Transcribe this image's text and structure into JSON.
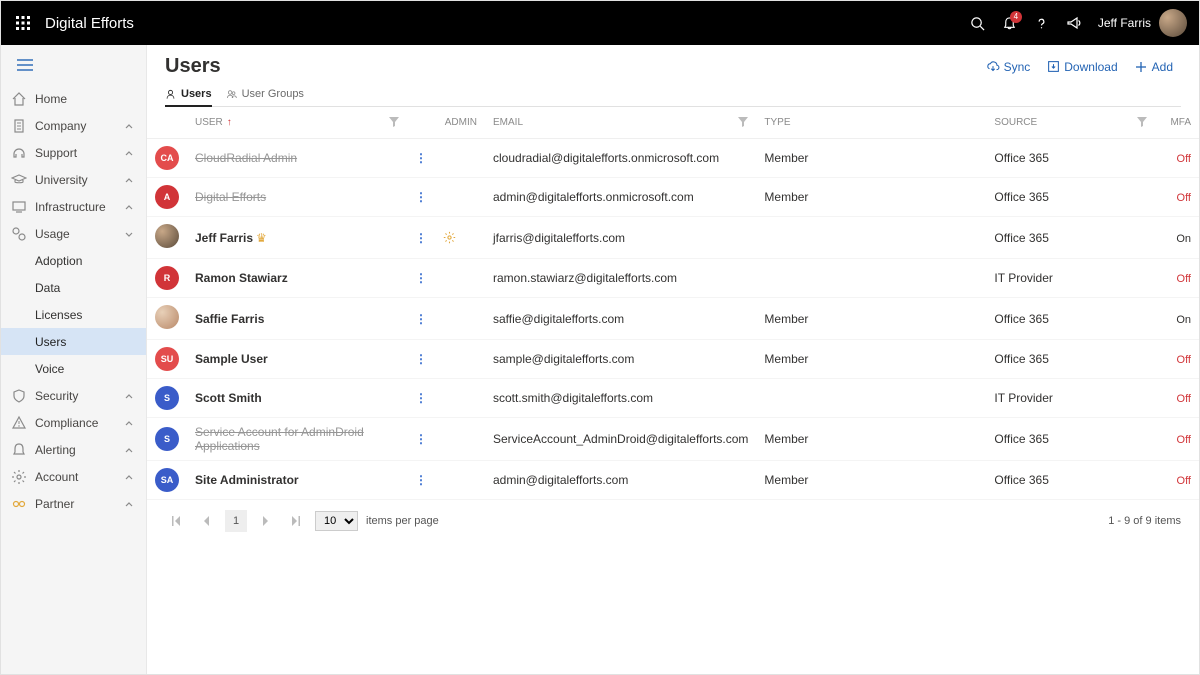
{
  "header": {
    "brand": "Digital Efforts",
    "notification_count": "4",
    "user_name": "Jeff Farris"
  },
  "sidebar": {
    "items": [
      {
        "label": "Home",
        "icon": "home",
        "expandable": false
      },
      {
        "label": "Company",
        "icon": "building",
        "expandable": true
      },
      {
        "label": "Support",
        "icon": "headset",
        "expandable": true
      },
      {
        "label": "University",
        "icon": "grad-cap",
        "expandable": true
      },
      {
        "label": "Infrastructure",
        "icon": "monitor",
        "expandable": true
      },
      {
        "label": "Usage",
        "icon": "chart",
        "expandable": true,
        "open": true,
        "children": [
          {
            "label": "Adoption"
          },
          {
            "label": "Data"
          },
          {
            "label": "Licenses"
          },
          {
            "label": "Users",
            "active": true
          },
          {
            "label": "Voice"
          }
        ]
      },
      {
        "label": "Security",
        "icon": "shield",
        "expandable": true
      },
      {
        "label": "Compliance",
        "icon": "warning",
        "expandable": true
      },
      {
        "label": "Alerting",
        "icon": "bell",
        "expandable": true
      },
      {
        "label": "Account",
        "icon": "gear",
        "expandable": true
      },
      {
        "label": "Partner",
        "icon": "link",
        "expandable": true,
        "accent": true
      }
    ]
  },
  "page": {
    "title": "Users",
    "actions": {
      "sync": "Sync",
      "download": "Download",
      "add": "Add"
    },
    "tabs": [
      {
        "label": "Users",
        "active": true
      },
      {
        "label": "User Groups",
        "active": false
      }
    ]
  },
  "table": {
    "columns": {
      "user": "User",
      "admin": "Admin",
      "email": "Email",
      "type": "Type",
      "source": "Source",
      "mfa": "MFA"
    },
    "rows": [
      {
        "avatar": {
          "text": "CA",
          "class": "av-redl"
        },
        "name": "CloudRadial Admin",
        "strike": true,
        "admin": "",
        "email": "cloudradial@digitalefforts.onmicrosoft.com",
        "type": "Member",
        "source": "Office 365",
        "mfa": "Off"
      },
      {
        "avatar": {
          "text": "A",
          "class": "av-red"
        },
        "name": "Digital Efforts",
        "strike": true,
        "admin": "",
        "email": "admin@digitalefforts.onmicrosoft.com",
        "type": "Member",
        "source": "Office 365",
        "mfa": "Off"
      },
      {
        "avatar": {
          "text": "",
          "class": "av-photo1"
        },
        "name": "Jeff Farris",
        "crown": true,
        "admin": "gear",
        "email": "jfarris@digitalefforts.com",
        "type": "",
        "source": "Office 365",
        "mfa": "On"
      },
      {
        "avatar": {
          "text": "R",
          "class": "av-red"
        },
        "name": "Ramon Stawiarz",
        "admin": "",
        "email": "ramon.stawiarz@digitalefforts.com",
        "type": "",
        "source": "IT Provider",
        "mfa": "Off"
      },
      {
        "avatar": {
          "text": "",
          "class": "av-photo2"
        },
        "name": "Saffie Farris",
        "admin": "",
        "email": "saffie@digitalefforts.com",
        "type": "Member",
        "source": "Office 365",
        "mfa": "On"
      },
      {
        "avatar": {
          "text": "SU",
          "class": "av-redl"
        },
        "name": "Sample User",
        "admin": "",
        "email": "sample@digitalefforts.com",
        "type": "Member",
        "source": "Office 365",
        "mfa": "Off"
      },
      {
        "avatar": {
          "text": "S",
          "class": "av-blue"
        },
        "name": "Scott Smith",
        "admin": "",
        "email": "scott.smith@digitalefforts.com",
        "type": "",
        "source": "IT Provider",
        "mfa": "Off"
      },
      {
        "avatar": {
          "text": "S",
          "class": "av-blue"
        },
        "name": "Service Account for AdminDroid Applications",
        "strike": true,
        "admin": "",
        "email": "ServiceAccount_AdminDroid@digitalefforts.com",
        "type": "Member",
        "source": "Office 365",
        "mfa": "Off"
      },
      {
        "avatar": {
          "text": "SA",
          "class": "av-blue"
        },
        "name": "Site Administrator",
        "admin": "",
        "email": "admin@digitalefforts.com",
        "type": "Member",
        "source": "Office 365",
        "mfa": "Off"
      }
    ]
  },
  "pager": {
    "page": "1",
    "page_size": "10",
    "per_page_label": "items per page",
    "summary": "1 - 9 of 9 items"
  }
}
